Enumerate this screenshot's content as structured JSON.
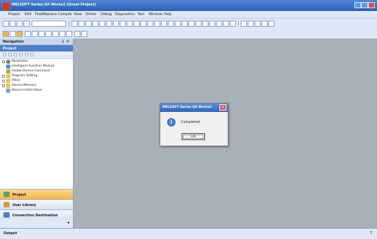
{
  "window": {
    "title": "MELSOFT Series GX Works2 (Unset Project)"
  },
  "menu": [
    "Project",
    "Edit",
    "Find/Replace",
    "Compile",
    "View",
    "Online",
    "Debug",
    "Diagnostics",
    "Tool",
    "Window",
    "Help"
  ],
  "navigation": {
    "title": "Navigation",
    "pin": "↓ ×",
    "project_header": "Project",
    "tree": [
      {
        "label": "Parameter",
        "level": 0
      },
      {
        "label": "Intelligent Function Module",
        "level": 1
      },
      {
        "label": "Global Device Comment",
        "level": 1
      },
      {
        "label": "Program Setting",
        "level": 0
      },
      {
        "label": "POUs",
        "level": 0
      },
      {
        "label": "Device Memory",
        "level": 0
      },
      {
        "label": "Device Initial Value",
        "level": 1
      }
    ],
    "buttons": [
      "Project",
      "User Library",
      "Connection Destination"
    ]
  },
  "output": {
    "title": "Output"
  },
  "dialog": {
    "title": "MELSOFT Series GX Works2",
    "message": "Completed.",
    "ok_label": "OK",
    "close_glyph": "×",
    "info_glyph": "i"
  },
  "colors": {
    "titlebar": "#2b5fb4",
    "workarea": "#aab0b8",
    "project_button": "#f3b549"
  }
}
